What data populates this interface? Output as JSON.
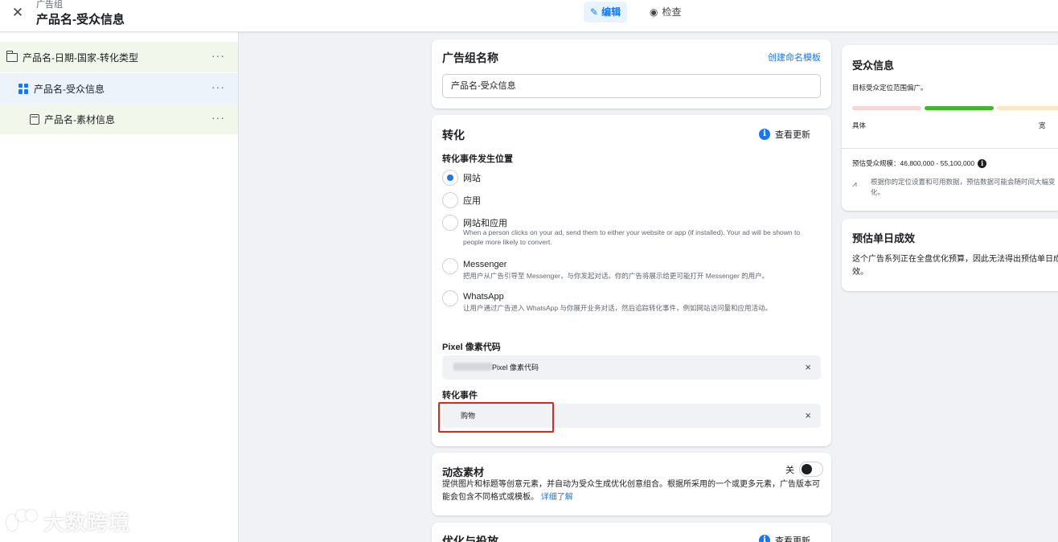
{
  "topbar": {
    "close_icon": "close-icon",
    "breadcrumb_label": "广告组",
    "title": "产品名-受众信息",
    "edit_label": "编辑",
    "review_label": "检查"
  },
  "sidebar": {
    "items": [
      {
        "label": "产品名-日期-国家-转化类型",
        "icon": "folder-icon",
        "menu": "···"
      },
      {
        "label": "产品名-受众信息",
        "icon": "grid-icon",
        "menu": "···"
      },
      {
        "label": "产品名-素材信息",
        "icon": "document-icon",
        "menu": "···"
      }
    ]
  },
  "watermark": {
    "text": "大数跨境"
  },
  "adset_name": {
    "title": "广告组名称",
    "template_link": "创建命名模板",
    "value": "产品名-受众信息"
  },
  "conversion": {
    "title": "转化",
    "see_updates": "查看更新",
    "location_label": "转化事件发生位置",
    "options": [
      {
        "label": "网站",
        "desc": "",
        "checked": true
      },
      {
        "label": "应用",
        "desc": "",
        "checked": false
      },
      {
        "label": "网站和应用",
        "desc": "When a person clicks on your ad, send them to either your website or app (if installed). Your ad will be shown to people more likely to convert.",
        "checked": false
      },
      {
        "label": "Messenger",
        "desc": "把用户从广告引导至 Messenger，与你发起对话。你的广告将展示给更可能打开 Messenger 的用户。",
        "checked": false
      },
      {
        "label": "WhatsApp",
        "desc": "让用户通过广告进入 WhatsApp 与你展开业务对话，然后追踪转化事件，例如网站访问量和应用活动。",
        "checked": false
      }
    ],
    "pixel_label": "Pixel 像素代码",
    "pixel_value": "Pixel 像素代码",
    "event_label": "转化事件",
    "event_value": "购物",
    "clear_symbol": "×"
  },
  "dynamic_creative": {
    "title": "动态素材",
    "toggle_label": "关",
    "toggle_on": false,
    "desc": "提供图片和标题等创意元素，并自动为受众生成优化创意组合。根据所采用的一个或更多元素，广告版本可能会包含不同格式或模板。",
    "learn_more": "详细了解"
  },
  "optimization": {
    "title": "优化与投放",
    "see_updates": "查看更新"
  },
  "audience": {
    "title": "受众信息",
    "subtitle": "目标受众定位范围偏广。",
    "specific_label": "具体",
    "broad_label": "宽",
    "size_text": "预估受众规模：46,800,000 - 55,100,000",
    "note": "根据你的定位设置和可用数据，预估数据可能会随时间大幅变化。",
    "meter_colors": {
      "narrow": "#f9d7d7",
      "ideal": "#42b72a",
      "broad": "#fbe7c6"
    }
  },
  "daily_results": {
    "title": "预估单日成效",
    "desc": "这个广告系列正在全盘优化预算，因此无法得出预估单日成效。"
  }
}
